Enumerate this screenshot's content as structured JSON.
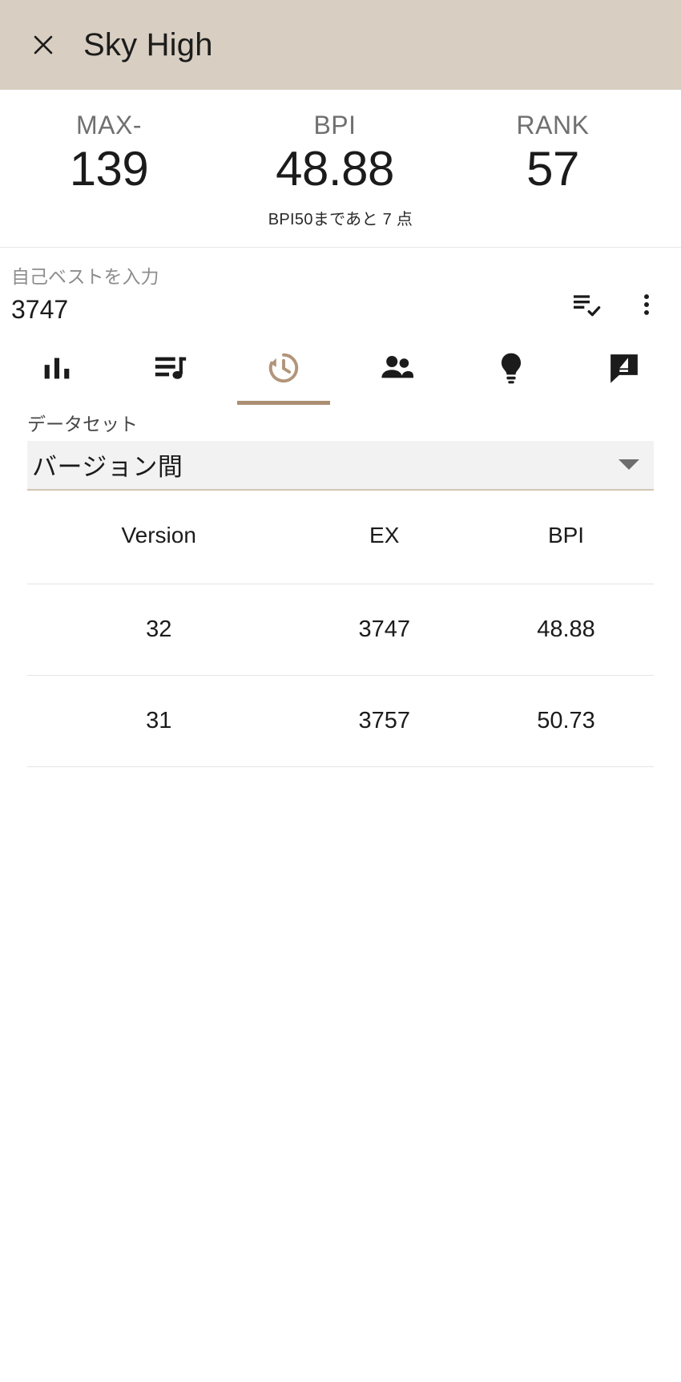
{
  "appbar": {
    "close_icon": "close-icon",
    "title": "Sky High",
    "background": "#d8cec2"
  },
  "stats": {
    "items": [
      {
        "label": "MAX-",
        "value": "139",
        "name": "max-minus"
      },
      {
        "label": "BPI",
        "value": "48.88",
        "name": "bpi"
      },
      {
        "label": "RANK",
        "value": "57",
        "name": "rank"
      }
    ],
    "note": "BPI50まであと 7 点"
  },
  "score_input": {
    "label": "自己ベストを入力",
    "value": "3747",
    "placeholder": "自己ベストを入力",
    "actions": [
      {
        "name": "playlist-add-check-icon"
      },
      {
        "name": "more-vert-icon"
      }
    ]
  },
  "tabs": {
    "active_index": 2,
    "accent": "#ab8f72",
    "items": [
      {
        "name": "tab-bar-chart",
        "icon": "bar-chart-icon"
      },
      {
        "name": "tab-queue-music",
        "icon": "queue-music-icon"
      },
      {
        "name": "tab-history",
        "icon": "history-icon"
      },
      {
        "name": "tab-people",
        "icon": "people-icon"
      },
      {
        "name": "tab-lightbulb",
        "icon": "lightbulb-icon"
      },
      {
        "name": "tab-rate-review",
        "icon": "rate-review-icon"
      }
    ]
  },
  "dataset": {
    "label": "データセット",
    "selected": "バージョン間",
    "caret_icon": "chevron-down-icon"
  },
  "chart_data": {
    "type": "table",
    "title": "バージョン間",
    "columns": [
      "Version",
      "EX",
      "BPI"
    ],
    "rows": [
      [
        "32",
        "3747",
        "48.88"
      ],
      [
        "31",
        "3757",
        "50.73"
      ]
    ]
  }
}
